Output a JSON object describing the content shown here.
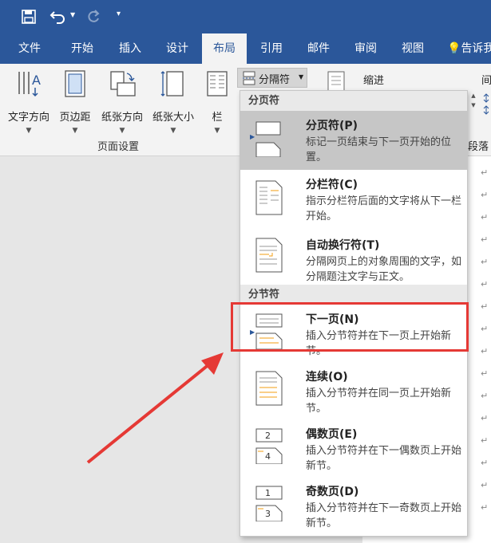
{
  "quick_access": {
    "save_icon": "save-icon",
    "undo_icon": "undo-icon",
    "redo_icon": "redo-icon",
    "customize_icon": "customize-qat-icon"
  },
  "tabs": [
    {
      "label": "文件"
    },
    {
      "label": "开始"
    },
    {
      "label": "插入"
    },
    {
      "label": "设计"
    },
    {
      "label": "布局"
    },
    {
      "label": "引用"
    },
    {
      "label": "邮件"
    },
    {
      "label": "审阅"
    },
    {
      "label": "视图"
    },
    {
      "label": "告诉我"
    }
  ],
  "active_tab": "布局",
  "ribbon": {
    "buttons": [
      {
        "label": "文字方向"
      },
      {
        "label": "页边距"
      },
      {
        "label": "纸张方向"
      },
      {
        "label": "纸张大小"
      },
      {
        "label": "栏"
      }
    ],
    "group_label": "页面设置",
    "breaks_button": "分隔符",
    "indent_label": "缩进",
    "spacing_label": "间",
    "paragraph_label": "段落"
  },
  "dropdown": {
    "page_breaks_header": "分页符",
    "section_breaks_header": "分节符",
    "items": [
      {
        "title": "分页符(P)",
        "desc": "标记一页结束与下一页开始的位置。"
      },
      {
        "title": "分栏符(C)",
        "desc": "指示分栏符后面的文字将从下一栏开始。"
      },
      {
        "title": "自动换行符(T)",
        "desc": "分隔网页上的对象周围的文字，如分隔题注文字与正文。"
      },
      {
        "title": "下一页(N)",
        "desc": "插入分节符并在下一页上开始新节。"
      },
      {
        "title": "连续(O)",
        "desc": "插入分节符并在同一页上开始新节。"
      },
      {
        "title": "偶数页(E)",
        "desc": "插入分节符并在下一偶数页上开始新节。"
      },
      {
        "title": "奇数页(D)",
        "desc": "插入分节符并在下一奇数页上开始新节。"
      }
    ]
  },
  "paragraph_mark": "↵",
  "colors": {
    "brand": "#2b579a",
    "highlight_box": "#e53935",
    "arrow": "#e53935"
  }
}
